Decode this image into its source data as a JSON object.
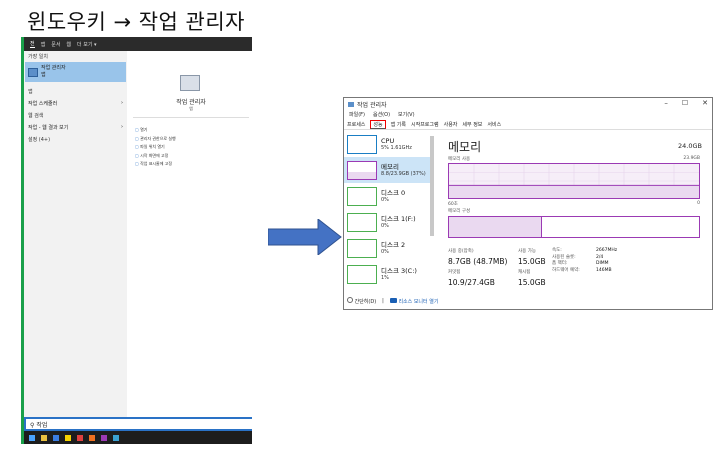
{
  "heading": "윈도우키 → 작업 관리자",
  "start": {
    "tabs": [
      "전",
      "앱",
      "문서",
      "웹",
      "더 보기 ▾"
    ],
    "best_match_label": "가장 일치",
    "best_title": "작업 관리자",
    "best_sub": "앱",
    "apps_label": "앱",
    "row1": "작업 스케줄러",
    "web_label": "웹 검색",
    "row2": "작업 - 웹 결과 보기",
    "settings_label": "설정 (4+)",
    "right_title": "작업 관리자",
    "right_sub": "앱",
    "actions": [
      "열기",
      "관리자 권한으로 실행",
      "파일 위치 열기",
      "시작 화면에 고정",
      "작업 표시줄에 고정"
    ],
    "search_value": "작업"
  },
  "tm": {
    "title": "작업 관리자",
    "window_controls": [
      "–",
      "☐",
      "✕"
    ],
    "menu": [
      "파일(F)",
      "옵션(O)",
      "보기(V)"
    ],
    "tabs": [
      "프로세스",
      "성능",
      "앱 기록",
      "시작프로그램",
      "사용자",
      "세부 정보",
      "서비스"
    ],
    "items": [
      {
        "name": "CPU",
        "value": "5% 1.61GHz",
        "color": "#1a7ec4"
      },
      {
        "name": "메모리",
        "value": "8.8/23.9GB (37%)",
        "color": "#9b3ab4"
      },
      {
        "name": "디스크 0",
        "value": "0%",
        "color": "#4caf50"
      },
      {
        "name": "디스크 1(F:)",
        "value": "0%",
        "color": "#4caf50"
      },
      {
        "name": "디스크 2",
        "value": "0%",
        "color": "#4caf50"
      },
      {
        "name": "디스크 3(C:)",
        "value": "1%",
        "color": "#4caf50"
      }
    ],
    "detail": {
      "title": "메모리",
      "total": "24.0GB",
      "usage_label": "메모리 사용",
      "usage_max": "23.9GB",
      "axis_left": "60초",
      "axis_right": "0",
      "composition_label": "메모리 구성",
      "usage_fraction": 0.37,
      "in_use_label": "사용 중(압축)",
      "in_use": "8.7GB (48.7MB)",
      "available_label": "사용 가능",
      "available": "15.0GB",
      "committed_label": "커밋됨",
      "committed": "10.9/27.4GB",
      "cached_label": "캐시됨",
      "cached": "15.0GB",
      "spec_labels": [
        "속도:",
        "사용된 슬롯:",
        "폼 팩터:",
        "하드웨어 예약:"
      ],
      "spec_values": [
        "2667MHz",
        "2/4",
        "DIMM",
        "146MB"
      ]
    },
    "bottom_less": "간단히(D)",
    "bottom_link": "리소스 모니터 열기"
  },
  "colors": {
    "memory": "#9b3ab4",
    "arrow": "#4472c4",
    "highlight": "#e00000"
  }
}
